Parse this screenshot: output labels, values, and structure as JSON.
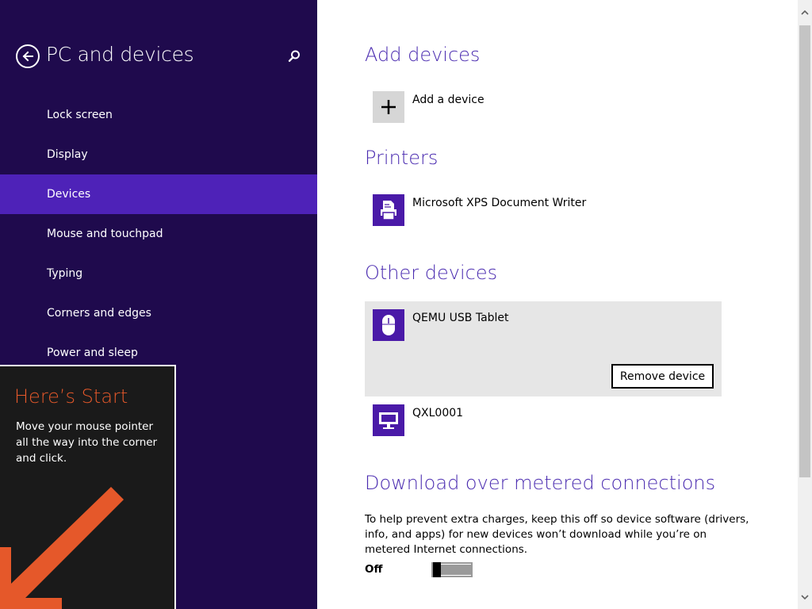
{
  "sidebar": {
    "title": "PC and devices",
    "back_icon": "back-arrow-icon",
    "search_icon": "search-icon",
    "items": [
      {
        "label": "Lock screen"
      },
      {
        "label": "Display"
      },
      {
        "label": "Devices",
        "selected": true
      },
      {
        "label": "Mouse and touchpad"
      },
      {
        "label": "Typing"
      },
      {
        "label": "Corners and edges"
      },
      {
        "label": "Power and sleep"
      }
    ]
  },
  "start_hint": {
    "title": "Here’s Start",
    "text": "Move your mouse pointer all the way into the corner and click.",
    "arrow_icon": "arrow-down-left-icon"
  },
  "content": {
    "add_devices": {
      "title": "Add devices",
      "add_label": "Add a device",
      "icon": "plus-icon"
    },
    "printers": {
      "title": "Printers",
      "items": [
        {
          "label": "Microsoft XPS Document Writer",
          "icon": "printer-icon"
        }
      ]
    },
    "other_devices": {
      "title": "Other devices",
      "items": [
        {
          "label": "QEMU USB Tablet",
          "icon": "mouse-icon",
          "selected": true
        },
        {
          "label": "QXL0001",
          "icon": "monitor-icon"
        }
      ],
      "remove_button": "Remove device"
    },
    "metered": {
      "title": "Download over metered connections",
      "description": "To help prevent extra charges, keep this off so device software (drivers, info, and apps) for new devices won’t download while you’re on metered Internet connections.",
      "toggle_label": "Off",
      "toggle_on": false
    }
  },
  "colors": {
    "sidebar_bg": "#1f0a4d",
    "sidebar_selected": "#4e22b8",
    "accent": "#4a2bb0",
    "tile_bg": "#4a1aa8",
    "hint_title": "#e5582a",
    "hint_arrow": "#e5582a",
    "hint_bg": "#1a1a1a"
  }
}
